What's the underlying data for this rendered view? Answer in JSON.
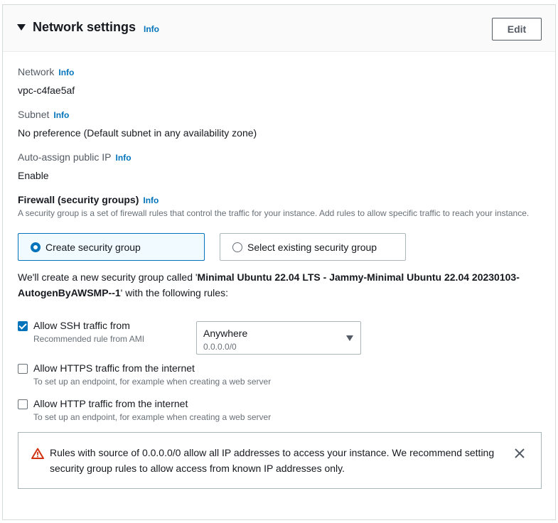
{
  "header": {
    "title": "Network settings",
    "info": "Info",
    "edit_label": "Edit"
  },
  "fields": {
    "network": {
      "label": "Network",
      "info": "Info",
      "value": "vpc-c4fae5af"
    },
    "subnet": {
      "label": "Subnet",
      "info": "Info",
      "value": "No preference (Default subnet in any availability zone)"
    },
    "auto_ip": {
      "label": "Auto-assign public IP",
      "info": "Info",
      "value": "Enable"
    }
  },
  "firewall": {
    "title": "Firewall (security groups)",
    "info": "Info",
    "description": "A security group is a set of firewall rules that control the traffic for your instance. Add rules to allow specific traffic to reach your instance.",
    "options": [
      {
        "label": "Create security group",
        "selected": true
      },
      {
        "label": "Select existing security group",
        "selected": false
      }
    ],
    "notice_prefix": "We'll create a new security group called '",
    "group_name": "Minimal Ubuntu 22.04 LTS - Jammy-Minimal Ubuntu 22.04 20230103-AutogenByAWSMP--1",
    "notice_suffix": "' with the following rules:"
  },
  "rules": [
    {
      "label": "Allow SSH traffic from",
      "sub": "Recommended rule from AMI",
      "checked": true
    },
    {
      "label": "Allow HTTPS traffic from the internet",
      "sub": "To set up an endpoint, for example when creating a web server",
      "checked": false
    },
    {
      "label": "Allow HTTP traffic from the internet",
      "sub": "To set up an endpoint, for example when creating a web server",
      "checked": false
    }
  ],
  "ssh_source": {
    "value": "Anywhere",
    "sub": "0.0.0.0/0"
  },
  "warning": {
    "text": "Rules with source of 0.0.0.0/0 allow all IP addresses to access your instance. We recommend setting security group rules to allow access from known IP addresses only.",
    "icon": "warning-icon",
    "color": "#d13212"
  },
  "colors": {
    "accent": "#0073bb",
    "text": "#16191f",
    "muted": "#687078"
  }
}
